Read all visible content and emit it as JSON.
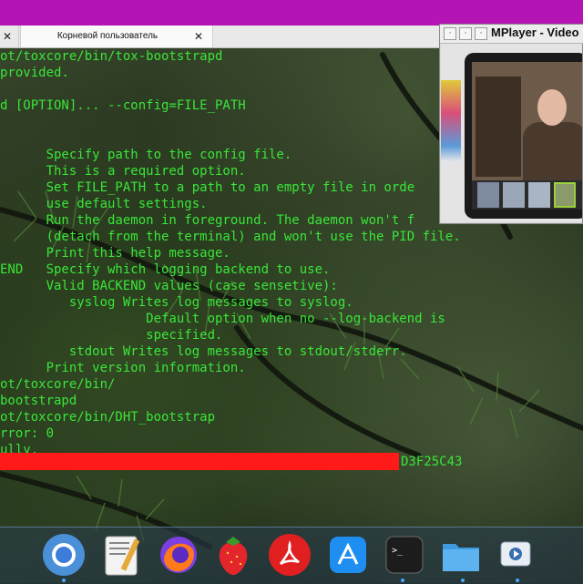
{
  "terminal": {
    "tabs": [
      {
        "label": "",
        "close_glyph": "✕"
      },
      {
        "label": "Корневой пользователь",
        "close_glyph": "✕"
      }
    ],
    "lines": [
      "ot/toxcore/bin/tox-bootstrapd",
      "provided.",
      "",
      "d [OPTION]... --config=FILE_PATH",
      "",
      "",
      "      Specify path to the config file.",
      "      This is a required option.",
      "      Set FILE_PATH to a path to an empty file in orde",
      "      use default settings.",
      "      Run the daemon in foreground. The daemon won't f",
      "      (detach from the terminal) and won't use the PID file.",
      "      Print this help message.",
      "END   Specify which logging backend to use.",
      "      Valid BACKEND values (case sensetive):",
      "         syslog Writes log messages to syslog.",
      "                   Default option when no --log-backend is",
      "                   specified.",
      "         stdout Writes log messages to stdout/stderr.",
      "      Print version information.",
      "ot/toxcore/bin/",
      "bootstrapd",
      "ot/toxcore/bin/DHT_bootstrap",
      "rror: 0",
      "ully."
    ],
    "hash_suffix": "D3F25C43",
    "text_color": "#39e639",
    "redaction_color": "#ff1a1a"
  },
  "mplayer": {
    "title": "MPlayer - Video",
    "buttons": [
      "·",
      "·",
      "·"
    ]
  },
  "dock": {
    "items": [
      {
        "name": "chromium-icon"
      },
      {
        "name": "text-editor-icon"
      },
      {
        "name": "firefox-icon"
      },
      {
        "name": "strawberry-icon"
      },
      {
        "name": "pdf-reader-icon"
      },
      {
        "name": "xcode-icon"
      },
      {
        "name": "terminal-icon",
        "glyph": ">_"
      },
      {
        "name": "folder-icon"
      },
      {
        "name": "media-player-icon"
      }
    ]
  },
  "colors": {
    "top_bar": "#b414b4",
    "accent_dot": "#4aa8ff"
  }
}
